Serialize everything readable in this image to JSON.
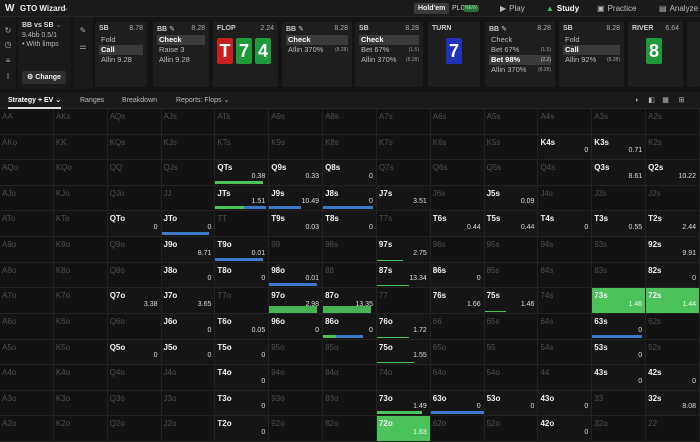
{
  "app": {
    "logo": "W",
    "name": "GTO Wizard",
    "game_modes": [
      "Hold'em",
      "PLO"
    ],
    "new_badge": "NEW"
  },
  "nav": [
    {
      "label": "Play",
      "icon": "play-icon",
      "active": false
    },
    {
      "label": "Study",
      "icon": "graduation-cap-icon",
      "active": true
    },
    {
      "label": "Practice",
      "icon": "gamepad-icon",
      "active": false
    },
    {
      "label": "Analyze",
      "icon": "chart-icon",
      "active": false
    }
  ],
  "spot": {
    "title": "BB vs SB",
    "stack": "9.4bb 0.5/1",
    "note": "• With limps",
    "change_label": "Change"
  },
  "actions": [
    {
      "pos": "SB",
      "amount": "8.78",
      "rows": [
        {
          "label": "Fold",
          "sub": ""
        },
        {
          "label": "Call",
          "sub": "",
          "selected": true
        },
        {
          "label": "Allin 9.28",
          "sub": ""
        }
      ]
    },
    {
      "pos": "BB",
      "amount": "8.28",
      "rows": [
        {
          "label": "Check",
          "sub": "",
          "selected": true
        },
        {
          "label": "Raise 3",
          "sub": ""
        },
        {
          "label": "Allin 9.28",
          "sub": ""
        }
      ]
    },
    {
      "pos": "BB",
      "amount": "8.28",
      "rows": [
        {
          "label": "Check",
          "sub": "",
          "selected": true
        },
        {
          "label": "Allin 370%",
          "sub": "(8.28)"
        }
      ]
    },
    {
      "pos": "SB",
      "amount": "8.28",
      "rows": [
        {
          "label": "Check",
          "sub": "",
          "selected": true
        },
        {
          "label": "Bet 67%",
          "sub": "(1.5)"
        },
        {
          "label": "Allin 370%",
          "sub": "(8.28)"
        }
      ]
    },
    {
      "pos": "BB",
      "amount": "8.28",
      "rows": [
        {
          "label": "Check",
          "sub": ""
        },
        {
          "label": "Bet 67%",
          "sub": "(1.5)"
        },
        {
          "label": "Bet 98%",
          "sub": "(2.2)",
          "selected": true
        },
        {
          "label": "Allin 370%",
          "sub": "(8.28)"
        }
      ]
    },
    {
      "pos": "SB",
      "amount": "8.28",
      "rows": [
        {
          "label": "Fold",
          "sub": ""
        },
        {
          "label": "Call",
          "sub": "",
          "selected": true
        },
        {
          "label": "Allin 92%",
          "sub": "(8.28)"
        }
      ]
    }
  ],
  "flop": {
    "label": "FLOP",
    "amount": "2.24",
    "cards": [
      {
        "rank": "T",
        "color": "#c8201f"
      },
      {
        "rank": "7",
        "color": "#1f9a3a"
      },
      {
        "rank": "4",
        "color": "#1f9a3a"
      }
    ]
  },
  "turn": {
    "label": "TURN",
    "amount": "",
    "cards": [
      {
        "rank": "7",
        "color": "#2233b8"
      }
    ]
  },
  "river": {
    "label": "RIVER",
    "amount": "6.64",
    "cards": [
      {
        "rank": "8",
        "color": "#1f9a3a"
      }
    ]
  },
  "tabs": [
    "Strategy + EV",
    "Ranges",
    "Breakdown",
    "Reports: Flops"
  ],
  "colors": {
    "green": "#4cc35a",
    "blue": "#3e78c9",
    "bg": "#141414"
  },
  "grid": [
    [
      {
        "n": "AA"
      },
      {
        "n": "AKs"
      },
      {
        "n": "AQs"
      },
      {
        "n": "AJs"
      },
      {
        "n": "ATs"
      },
      {
        "n": "A9s"
      },
      {
        "n": "A8s"
      },
      {
        "n": "A7s"
      },
      {
        "n": "A6s"
      },
      {
        "n": "A5s"
      },
      {
        "n": "A4s"
      },
      {
        "n": "A3s"
      },
      {
        "n": "A2s"
      }
    ],
    [
      {
        "n": "AKo"
      },
      {
        "n": "KK"
      },
      {
        "n": "KQs"
      },
      {
        "n": "KJs"
      },
      {
        "n": "KTs"
      },
      {
        "n": "K9s"
      },
      {
        "n": "K8s"
      },
      {
        "n": "K7s"
      },
      {
        "n": "K6s"
      },
      {
        "n": "K5s"
      },
      {
        "n": "K4s",
        "a": 1,
        "ev": "0"
      },
      {
        "n": "K3s",
        "a": 1,
        "ev": "0.71"
      },
      {
        "n": "K2s"
      }
    ],
    [
      {
        "n": "AQo"
      },
      {
        "n": "KQo"
      },
      {
        "n": "QQ"
      },
      {
        "n": "QJs"
      },
      {
        "n": "QTs",
        "a": 1,
        "ev": "0.38",
        "g": 0.9,
        "gp": 0.15
      },
      {
        "n": "Q9s",
        "a": 1,
        "ev": "0.33"
      },
      {
        "n": "Q8s",
        "a": 1,
        "ev": "0"
      },
      {
        "n": "Q7s"
      },
      {
        "n": "Q6s"
      },
      {
        "n": "Q5s"
      },
      {
        "n": "Q4s"
      },
      {
        "n": "Q3s",
        "a": 1,
        "ev": "8.61"
      },
      {
        "n": "Q2s",
        "a": 1,
        "ev": "10.22"
      }
    ],
    [
      {
        "n": "AJo"
      },
      {
        "n": "KJo"
      },
      {
        "n": "QJo"
      },
      {
        "n": "JJ"
      },
      {
        "n": "JTs",
        "a": 1,
        "ev": "1.51",
        "g": 0.55,
        "b": 0.4
      },
      {
        "n": "J9s",
        "a": 1,
        "ev": "10.49",
        "b": 0.6
      },
      {
        "n": "J8s",
        "a": 1,
        "ev": "0",
        "b": 0.95
      },
      {
        "n": "J7s",
        "a": 1,
        "ev": "3.51"
      },
      {
        "n": "J6s"
      },
      {
        "n": "J5s",
        "a": 1,
        "ev": "0.09"
      },
      {
        "n": "J4s"
      },
      {
        "n": "J3s"
      },
      {
        "n": "J2s"
      }
    ],
    [
      {
        "n": "ATo"
      },
      {
        "n": "KTo"
      },
      {
        "n": "QTo",
        "a": 1,
        "ev": "0"
      },
      {
        "n": "JTo",
        "a": 1,
        "ev": "0",
        "b": 0.9
      },
      {
        "n": "TT"
      },
      {
        "n": "T9s",
        "a": 1,
        "ev": "0.03"
      },
      {
        "n": "T8s",
        "a": 1,
        "ev": "0"
      },
      {
        "n": "T7s"
      },
      {
        "n": "T6s",
        "a": 1,
        "ev": "0.44"
      },
      {
        "n": "T5s",
        "a": 1,
        "ev": "0.44"
      },
      {
        "n": "T4s",
        "a": 1,
        "ev": "0"
      },
      {
        "n": "T3s",
        "a": 1,
        "ev": "0.55"
      },
      {
        "n": "T2s",
        "a": 1,
        "ev": "2.44"
      }
    ],
    [
      {
        "n": "A9o"
      },
      {
        "n": "K9o"
      },
      {
        "n": "Q9o"
      },
      {
        "n": "J9o",
        "a": 1,
        "ev": "8.71"
      },
      {
        "n": "T9o",
        "a": 1,
        "ev": "0.01",
        "b": 0.9
      },
      {
        "n": "99"
      },
      {
        "n": "98s"
      },
      {
        "n": "97s",
        "a": 1,
        "ev": "2.75",
        "gp": 0.5
      },
      {
        "n": "96s"
      },
      {
        "n": "95s"
      },
      {
        "n": "94s"
      },
      {
        "n": "93s"
      },
      {
        "n": "92s",
        "a": 1,
        "ev": "9.91"
      }
    ],
    [
      {
        "n": "A8o"
      },
      {
        "n": "K8o"
      },
      {
        "n": "Q8o"
      },
      {
        "n": "J8o",
        "a": 1,
        "ev": "0"
      },
      {
        "n": "T8o",
        "a": 1,
        "ev": "0"
      },
      {
        "n": "98o",
        "a": 1,
        "ev": "0.01",
        "b": 0.9
      },
      {
        "n": "88"
      },
      {
        "n": "87s",
        "a": 1,
        "ev": "13.34",
        "gp": 0.6
      },
      {
        "n": "86s",
        "a": 1,
        "ev": "0"
      },
      {
        "n": "85s"
      },
      {
        "n": "84s"
      },
      {
        "n": "83s"
      },
      {
        "n": "82s",
        "a": 1,
        "ev": "0"
      }
    ],
    [
      {
        "n": "A7o"
      },
      {
        "n": "K7o"
      },
      {
        "n": "Q7o",
        "a": 1,
        "ev": "3.38"
      },
      {
        "n": "J7o",
        "a": 1,
        "ev": "3.65"
      },
      {
        "n": "T7o"
      },
      {
        "n": "97o",
        "a": 1,
        "ev": "2.98",
        "g": 0.9,
        "h": 1
      },
      {
        "n": "87o",
        "a": 1,
        "ev": "13.35",
        "g": 0.9,
        "h": 1
      },
      {
        "n": "77"
      },
      {
        "n": "76s",
        "a": 1,
        "ev": "1.66"
      },
      {
        "n": "75s",
        "a": 1,
        "ev": "1.46",
        "gp": 0.4
      },
      {
        "n": "74s"
      },
      {
        "n": "73s",
        "a": 1,
        "ev": "1.46",
        "full": 1
      },
      {
        "n": "72s",
        "a": 1,
        "ev": "1.44",
        "full": 1
      }
    ],
    [
      {
        "n": "A6o"
      },
      {
        "n": "K6o"
      },
      {
        "n": "Q6o"
      },
      {
        "n": "J6o",
        "a": 1,
        "ev": "0"
      },
      {
        "n": "T6o",
        "a": 1,
        "ev": "0.05"
      },
      {
        "n": "96o",
        "a": 1,
        "ev": "0"
      },
      {
        "n": "86o",
        "a": 1,
        "ev": "0",
        "g": 0.25,
        "b": 0.5
      },
      {
        "n": "76o",
        "a": 1,
        "ev": "1.72",
        "gp": 0.6
      },
      {
        "n": "66"
      },
      {
        "n": "65s"
      },
      {
        "n": "64s"
      },
      {
        "n": "63s",
        "a": 1,
        "ev": "0",
        "b": 0.95
      },
      {
        "n": "62s"
      }
    ],
    [
      {
        "n": "A5o"
      },
      {
        "n": "K5o"
      },
      {
        "n": "Q5o",
        "a": 1,
        "ev": "0"
      },
      {
        "n": "J5o",
        "a": 1,
        "ev": "0"
      },
      {
        "n": "T5o",
        "a": 1,
        "ev": "0"
      },
      {
        "n": "95o"
      },
      {
        "n": "85o"
      },
      {
        "n": "75o",
        "a": 1,
        "ev": "1.55",
        "gp": 0.7
      },
      {
        "n": "65o"
      },
      {
        "n": "55"
      },
      {
        "n": "54s"
      },
      {
        "n": "53s",
        "a": 1,
        "ev": "0"
      },
      {
        "n": "52s"
      }
    ],
    [
      {
        "n": "A4o"
      },
      {
        "n": "K4o"
      },
      {
        "n": "Q4o"
      },
      {
        "n": "J4o"
      },
      {
        "n": "T4o",
        "a": 1,
        "ev": "0"
      },
      {
        "n": "94o"
      },
      {
        "n": "84o"
      },
      {
        "n": "74o"
      },
      {
        "n": "64o"
      },
      {
        "n": "54o"
      },
      {
        "n": "44"
      },
      {
        "n": "43s",
        "a": 1,
        "ev": "0"
      },
      {
        "n": "42s",
        "a": 1,
        "ev": "0"
      }
    ],
    [
      {
        "n": "A3o"
      },
      {
        "n": "K3o"
      },
      {
        "n": "Q3o"
      },
      {
        "n": "J3o"
      },
      {
        "n": "T3o",
        "a": 1,
        "ev": "0"
      },
      {
        "n": "93o"
      },
      {
        "n": "83o"
      },
      {
        "n": "73o",
        "a": 1,
        "ev": "1.49",
        "g": 0.85
      },
      {
        "n": "63o",
        "a": 1,
        "ev": "0",
        "b": 1
      },
      {
        "n": "53o",
        "a": 1,
        "ev": "0"
      },
      {
        "n": "43o",
        "a": 1,
        "ev": "0"
      },
      {
        "n": "33"
      },
      {
        "n": "32s",
        "a": 1,
        "ev": "8.08"
      }
    ],
    [
      {
        "n": "A2o"
      },
      {
        "n": "K2o"
      },
      {
        "n": "Q2o"
      },
      {
        "n": "J2o"
      },
      {
        "n": "T2o",
        "a": 1,
        "ev": "0"
      },
      {
        "n": "92o"
      },
      {
        "n": "82o"
      },
      {
        "n": "72o",
        "a": 1,
        "ev": "1.63",
        "full": 1
      },
      {
        "n": "62o"
      },
      {
        "n": "52o"
      },
      {
        "n": "42o",
        "a": 1,
        "ev": "0"
      },
      {
        "n": "32o"
      },
      {
        "n": "22"
      }
    ]
  ]
}
